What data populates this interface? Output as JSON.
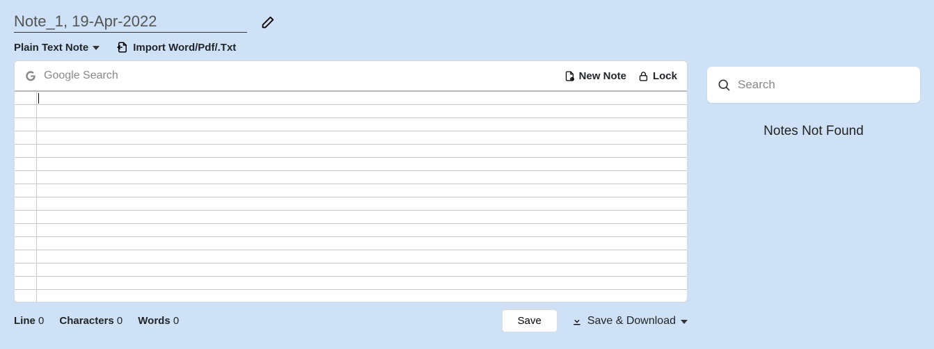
{
  "header": {
    "title": "Note_1, 19-Apr-2022"
  },
  "toolbar": {
    "note_type": "Plain Text Note",
    "import_label": "Import Word/Pdf/.Txt"
  },
  "panel": {
    "search_placeholder": "Google Search",
    "new_note": "New Note",
    "lock": "Lock"
  },
  "status": {
    "line_label": "Line",
    "line_value": "0",
    "chars_label": "Characters",
    "chars_value": "0",
    "words_label": "Words",
    "words_value": "0",
    "save": "Save",
    "save_download": "Save & Download"
  },
  "sidebar": {
    "search_placeholder": "Search",
    "empty_message": "Notes Not Found"
  }
}
